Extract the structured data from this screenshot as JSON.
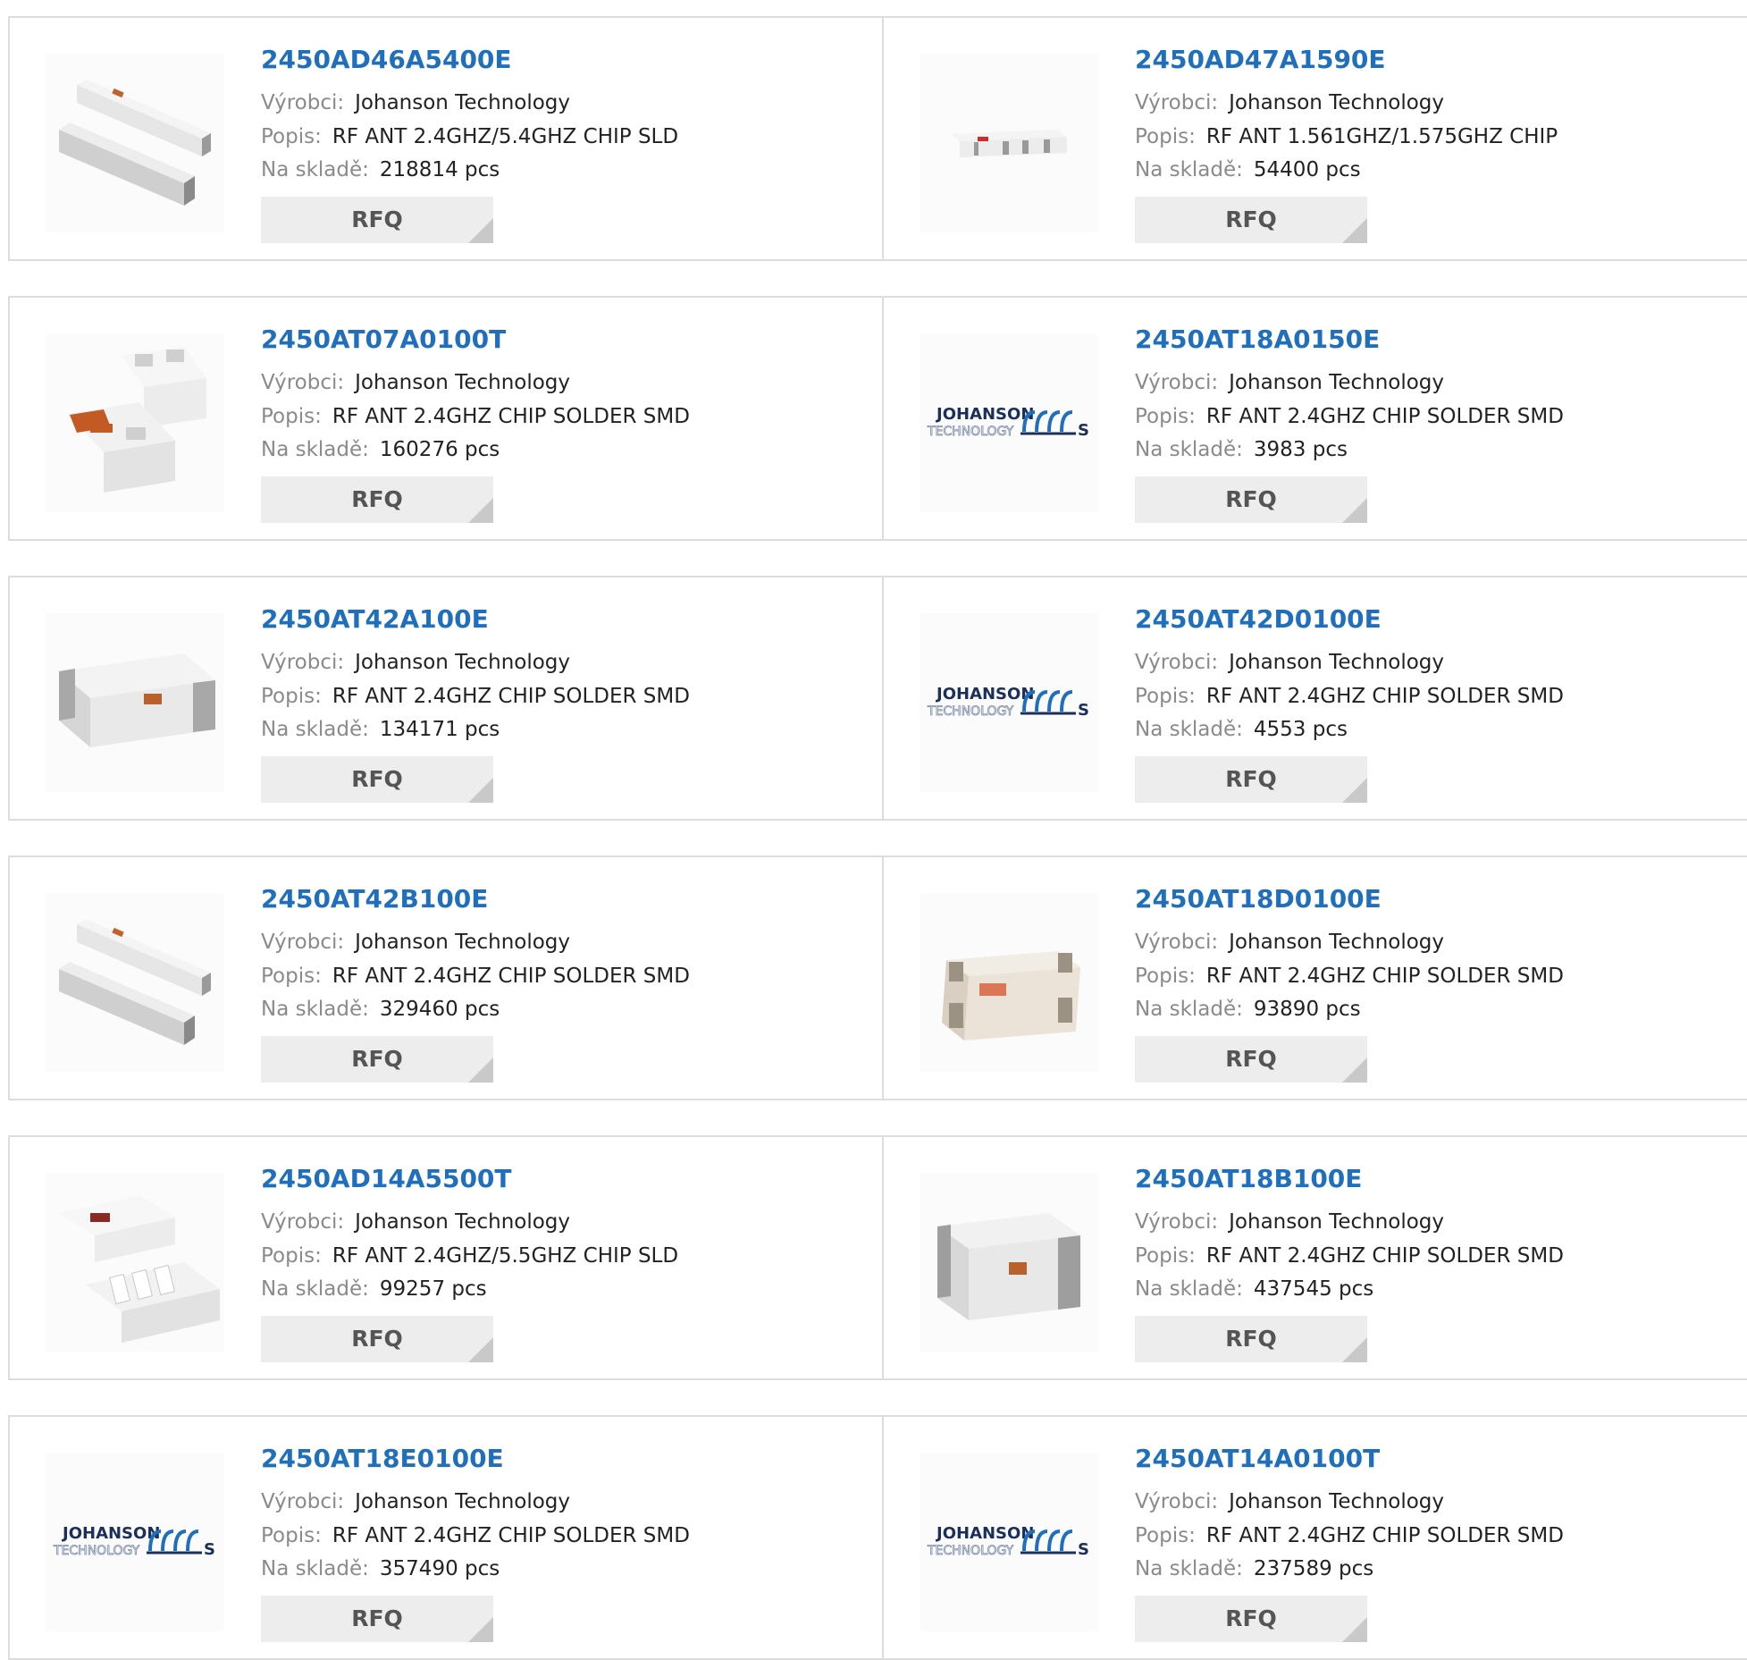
{
  "labels": {
    "manufacturer": "Výrobci:",
    "description": "Popis:",
    "stock": "Na skladě:",
    "rfq": "RFQ"
  },
  "colors": {
    "part_link": "#1f6fbd",
    "border": "#dddddd",
    "button_bg": "#ededed"
  },
  "products": [
    {
      "part": "2450AD46A5400E",
      "manufacturer": "Johanson Technology",
      "description": "RF ANT 2.4GHZ/5.4GHZ CHIP SLD",
      "stock": "218814 pcs",
      "image": "chip-pair-long"
    },
    {
      "part": "2450AD47A1590E",
      "manufacturer": "Johanson Technology",
      "description": "RF ANT 1.561GHZ/1.575GHZ CHIP",
      "stock": "54400 pcs",
      "image": "chip-small-striped"
    },
    {
      "part": "2450AT07A0100T",
      "manufacturer": "Johanson Technology",
      "description": "RF ANT 2.4GHZ CHIP SOLDER SMD",
      "stock": "160276 pcs",
      "image": "chip-pair-pads"
    },
    {
      "part": "2450AT18A0150E",
      "manufacturer": "Johanson Technology",
      "description": "RF ANT 2.4GHZ CHIP SOLDER SMD",
      "stock": "3983 pcs",
      "image": "johanson-logo"
    },
    {
      "part": "2450AT42A100E",
      "manufacturer": "Johanson Technology",
      "description": "RF ANT 2.4GHZ CHIP SOLDER SMD",
      "stock": "134171 pcs",
      "image": "chip-single-long"
    },
    {
      "part": "2450AT42D0100E",
      "manufacturer": "Johanson Technology",
      "description": "RF ANT 2.4GHZ CHIP SOLDER SMD",
      "stock": "4553 pcs",
      "image": "johanson-logo"
    },
    {
      "part": "2450AT42B100E",
      "manufacturer": "Johanson Technology",
      "description": "RF ANT 2.4GHZ CHIP SOLDER SMD",
      "stock": "329460 pcs",
      "image": "chip-pair-long"
    },
    {
      "part": "2450AT18D0100E",
      "manufacturer": "Johanson Technology",
      "description": "RF ANT 2.4GHZ CHIP SOLDER SMD",
      "stock": "93890 pcs",
      "image": "chip-beige"
    },
    {
      "part": "2450AD14A5500T",
      "manufacturer": "Johanson Technology",
      "description": "RF ANT 2.4GHZ/5.5GHZ CHIP SLD",
      "stock": "99257 pcs",
      "image": "chip-pair-pattern"
    },
    {
      "part": "2450AT18B100E",
      "manufacturer": "Johanson Technology",
      "description": "RF ANT 2.4GHZ CHIP SOLDER SMD",
      "stock": "437545 pcs",
      "image": "chip-single-block"
    },
    {
      "part": "2450AT18E0100E",
      "manufacturer": "Johanson Technology",
      "description": "RF ANT 2.4GHZ CHIP SOLDER SMD",
      "stock": "357490 pcs",
      "image": "johanson-logo"
    },
    {
      "part": "2450AT14A0100T",
      "manufacturer": "Johanson Technology",
      "description": "RF ANT 2.4GHZ CHIP SOLDER SMD",
      "stock": "237589 pcs",
      "image": "johanson-logo"
    }
  ]
}
